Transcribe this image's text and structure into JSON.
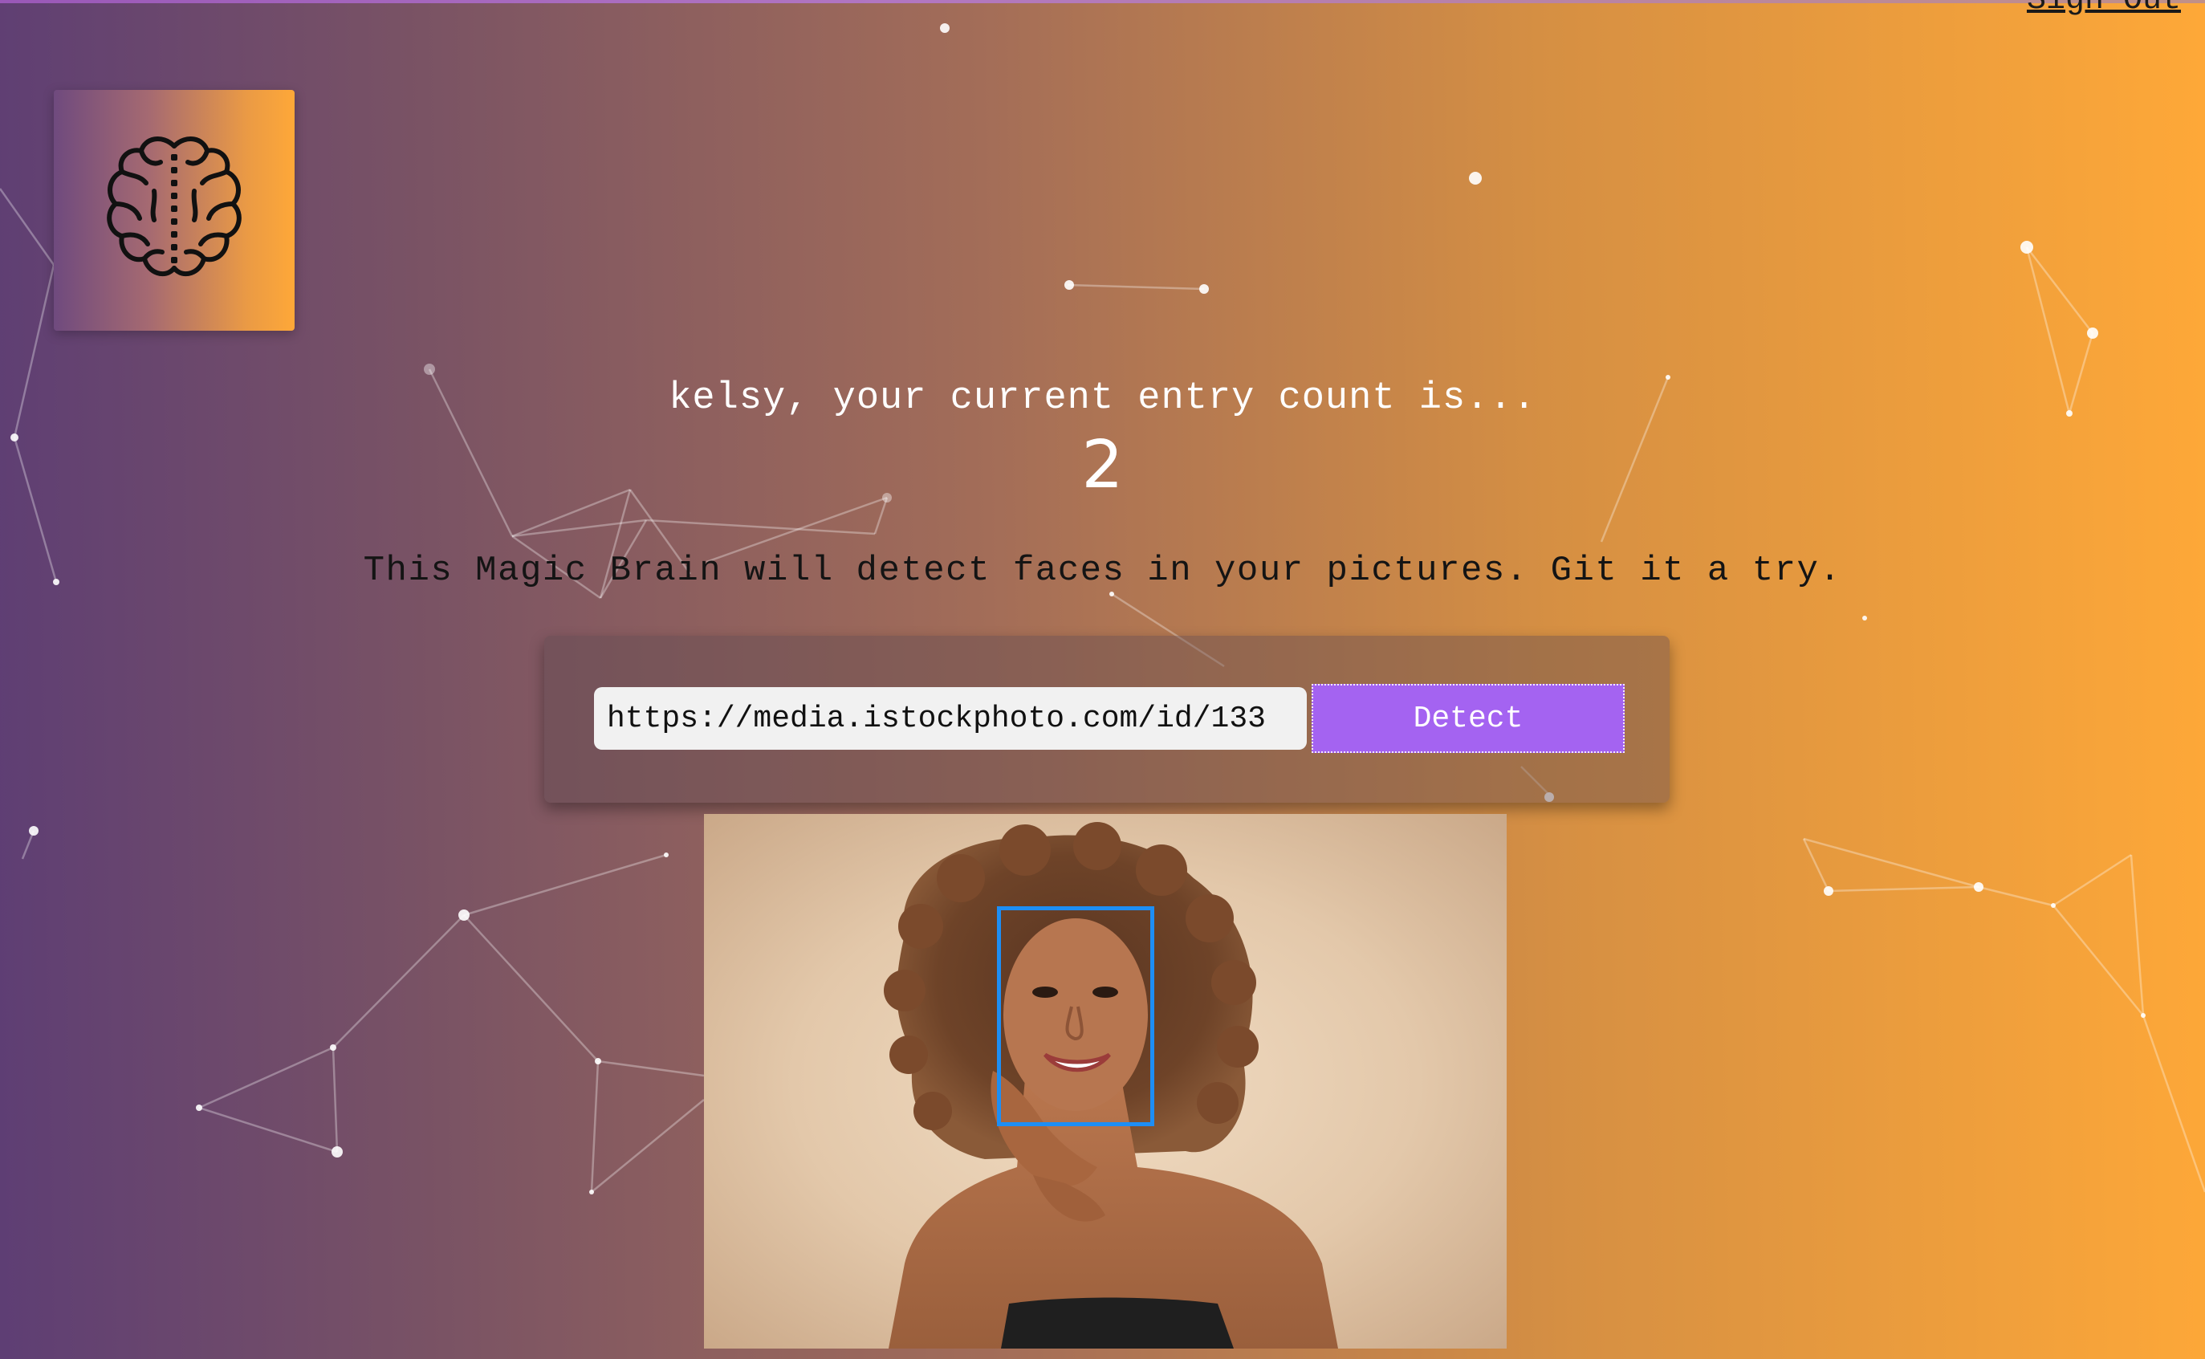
{
  "header": {
    "signout_label": "Sign Out"
  },
  "logo": {
    "icon": "brain-icon"
  },
  "greeting": {
    "text": "kelsy, your current entry count is...",
    "count": "2"
  },
  "description": "This Magic Brain will detect faces in your pictures. Git it a try.",
  "form": {
    "url_value": "https://media.istockphoto.com/id/133",
    "detect_label": "Detect"
  },
  "colors": {
    "gradient_start": "#5e3e74",
    "gradient_end": "#fea838",
    "button": "#a463f1",
    "face_box": "#1d8ef5"
  }
}
